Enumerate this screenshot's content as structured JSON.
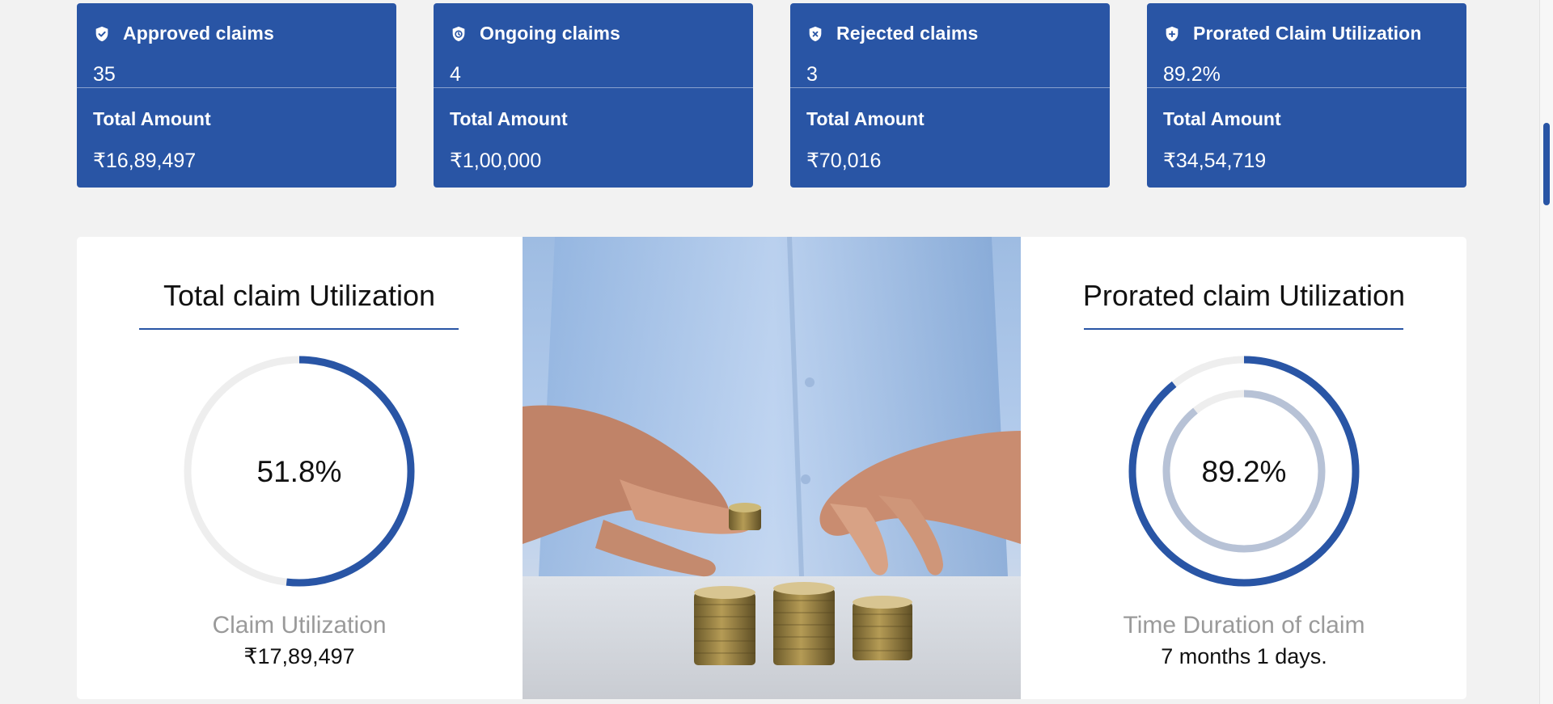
{
  "cards": [
    {
      "title": "Approved claims",
      "icon": "shield-check-icon",
      "count": "35",
      "amount_label": "Total Amount",
      "amount": "₹16,89,497"
    },
    {
      "title": "Ongoing claims",
      "icon": "shield-clock-icon",
      "count": "4",
      "amount_label": "Total Amount",
      "amount": "₹1,00,000"
    },
    {
      "title": "Rejected claims",
      "icon": "shield-x-icon",
      "count": "3",
      "amount_label": "Total Amount",
      "amount": "₹70,016"
    },
    {
      "title": "Prorated Claim Utilization",
      "icon": "shield-plus-icon",
      "count": "89.2%",
      "amount_label": "Total Amount",
      "amount": "₹34,54,719"
    }
  ],
  "total_utilization": {
    "title": "Total claim Utilization",
    "percent_label": "51.8%",
    "percent": 51.8,
    "caption": "Claim Utilization",
    "value": "₹17,89,497"
  },
  "prorated_utilization": {
    "title": "Prorated claim Utilization",
    "percent_label": "89.2%",
    "percent": 89.2,
    "inner_percent": 89.2,
    "caption": "Time Duration of claim",
    "value": "7 months 1 days."
  },
  "colors": {
    "brand_blue": "#2955a5",
    "track_gray": "#eeeeee",
    "inner_ring": "#b7c2d6",
    "page_bg": "#f2f2f2"
  }
}
